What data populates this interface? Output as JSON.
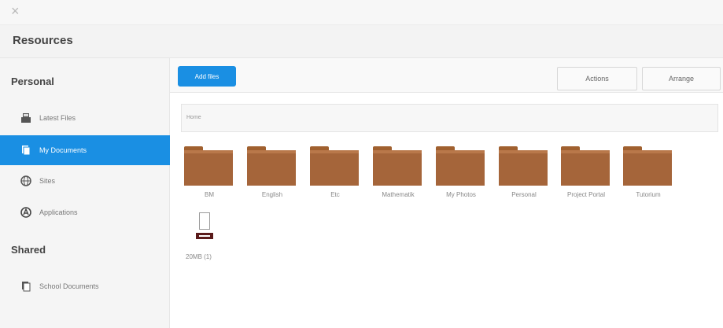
{
  "header": {
    "close_symbol": "×",
    "title": "Resources"
  },
  "sidebar": {
    "personal_heading": "Personal",
    "shared_heading": "Shared",
    "items": [
      {
        "label": "Latest Files",
        "icon": "drawer-icon",
        "active": false
      },
      {
        "label": "My Documents",
        "icon": "documents-icon",
        "active": true
      },
      {
        "label": "Sites",
        "icon": "globe-icon",
        "active": false
      },
      {
        "label": "Applications",
        "icon": "applications-icon",
        "active": false
      },
      {
        "label": "School Documents",
        "icon": "documents-icon",
        "active": false
      }
    ]
  },
  "toolbar": {
    "add_files_label": "Add files",
    "actions_label": "Actions",
    "arrange_label": "Arrange"
  },
  "breadcrumb": "Home",
  "folders": [
    {
      "name": "BM"
    },
    {
      "name": "English"
    },
    {
      "name": "Etc"
    },
    {
      "name": "Mathematik"
    },
    {
      "name": "My Photos"
    },
    {
      "name": "Personal"
    },
    {
      "name": "Project Portal"
    },
    {
      "name": "Tutorium"
    }
  ],
  "files": [
    {
      "name": "20MB (1)",
      "type": "pdf"
    }
  ],
  "colors": {
    "accent": "#1a8fe3",
    "folder": "#a5653a",
    "pdf_band": "#5a1a1a"
  }
}
